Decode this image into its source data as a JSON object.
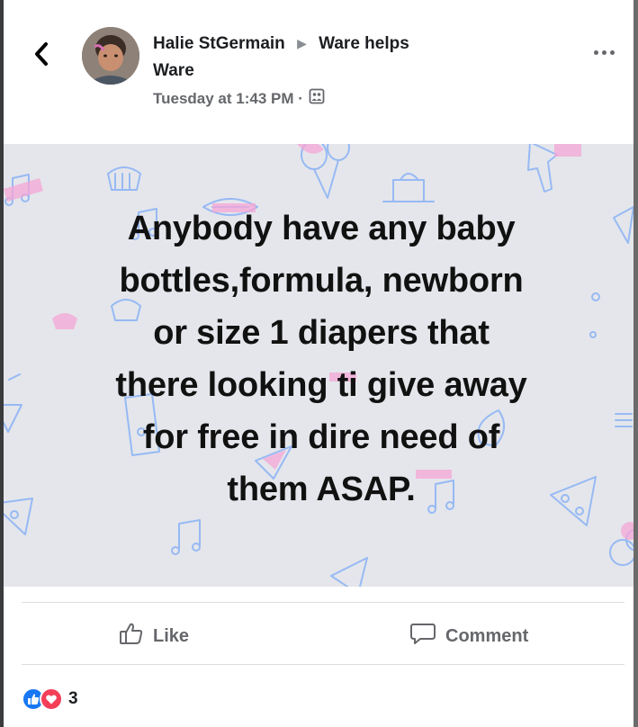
{
  "post": {
    "author": "Halie StGermain",
    "group": "Ware helps",
    "group_line2": "Ware",
    "timestamp": "Tuesday at 1:43 PM ·",
    "text_lines": [
      "Anybody have any baby",
      "bottles,formula, newborn",
      "or size 1 diapers that",
      "there looking ti give away",
      "for free in dire need of",
      "them ASAP."
    ]
  },
  "actions": {
    "like_label": "Like",
    "comment_label": "Comment"
  },
  "reactions": {
    "count": "3"
  },
  "colors": {
    "background_pattern": "#e4e6eb",
    "doodle_blue": "#8fb5f5",
    "doodle_pink": "#f6a6d6",
    "like_blue": "#1877f2",
    "love_red": "#f33e58"
  },
  "icons": [
    "back-arrow-icon",
    "more-options-icon",
    "audience-icon",
    "like-icon",
    "comment-icon",
    "like-reaction-icon",
    "love-reaction-icon"
  ]
}
